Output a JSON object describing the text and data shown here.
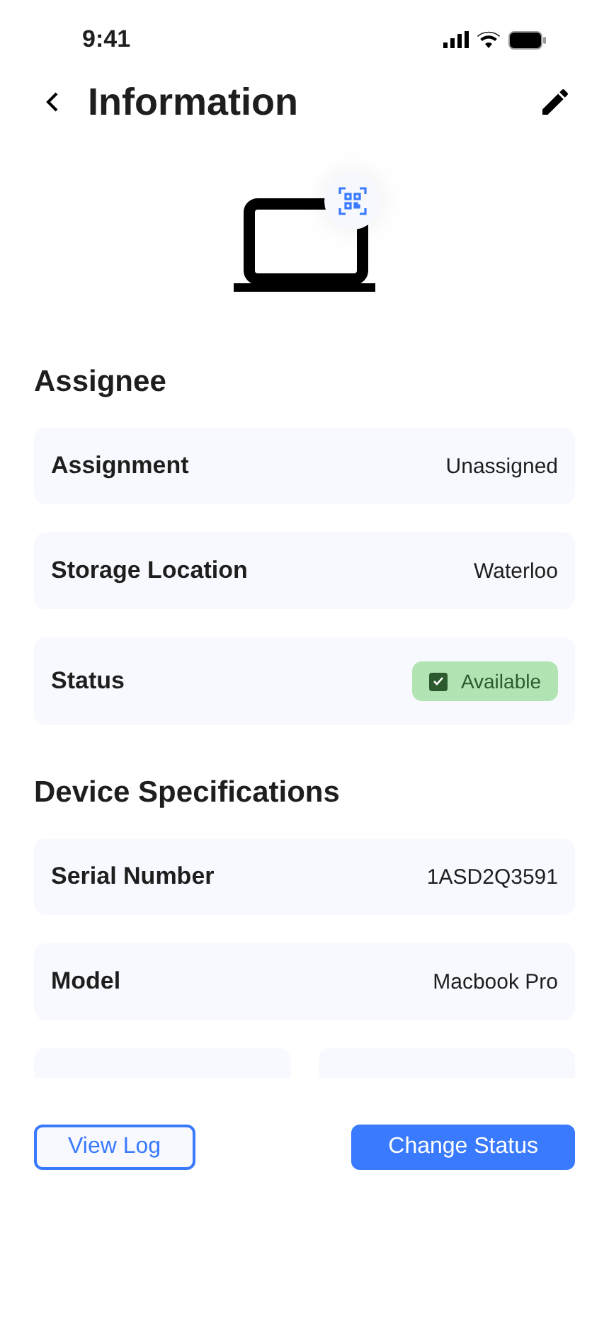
{
  "status_bar": {
    "time": "9:41"
  },
  "header": {
    "title": "Information"
  },
  "sections": [
    {
      "title": "Assignee",
      "rows": [
        {
          "kind": "text",
          "label": "Assignment",
          "value": "Unassigned"
        },
        {
          "kind": "text",
          "label": "Storage Location",
          "value": "Waterloo"
        },
        {
          "kind": "badge",
          "label": "Status",
          "value": "Available",
          "checked": true
        }
      ]
    },
    {
      "title": "Device Specifications",
      "rows": [
        {
          "kind": "text",
          "label": "Serial Number",
          "value": "1ASD2Q3591"
        },
        {
          "kind": "text",
          "label": "Model",
          "value": "Macbook Pro"
        }
      ]
    }
  ],
  "buttons": [
    {
      "label": "View Log",
      "kind": "outline"
    },
    {
      "label": "Change Status",
      "kind": "primary"
    }
  ]
}
